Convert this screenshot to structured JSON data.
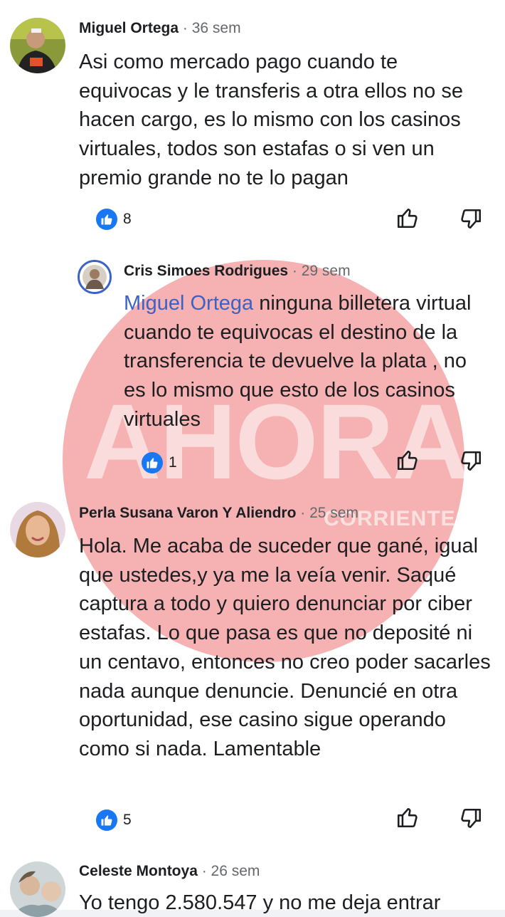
{
  "watermark": {
    "text": "AHORA",
    "sub": "CORRIENTE"
  },
  "comments": [
    {
      "author": "Miguel Ortega",
      "time": "· 36 sem",
      "text": "Asi como mercado pago cuando te equivocas y le transferis a otra ellos no se hacen cargo, es lo mismo con los casinos virtuales, todos son estafas o si ven un premio grande no te lo pagan",
      "likes": "8"
    },
    {
      "author": "Cris Simoes Rodrigues",
      "time": "· 29 sem",
      "mention": "Miguel Ortega",
      "text": " ninguna billetera virtual cuando te equivocas el destino de la transferencia te devuelve la plata , no es lo mismo que esto de los casinos virtuales",
      "likes": "1"
    },
    {
      "author": "Perla Susana Varon Y Aliendro",
      "time": "· 25 sem",
      "text": "Hola. Me acaba de suceder que gané, igual que ustedes,y ya me la veía venir. Saqué captura a todo y quiero denunciar por ciber estafas. Lo que pasa es que no deposité ni un centavo, entonces no creo poder sacarles nada aunque denuncie. Denuncié en otra oportunidad, ese casino sigue operando como si nada. Lamentable",
      "likes": "5"
    },
    {
      "author": "Celeste Montoya",
      "time": "· 26 sem",
      "text": "Yo tengo 2.580.547 y no me deja entrar"
    }
  ],
  "icons": {
    "like_reaction": "like-reaction-icon",
    "upvote": "thumbs-up-outline-icon",
    "downvote": "thumbs-down-outline-icon"
  },
  "colors": {
    "mention": "#3b62c4",
    "like": "#1877f2",
    "watermark": "#f5a5a5"
  }
}
